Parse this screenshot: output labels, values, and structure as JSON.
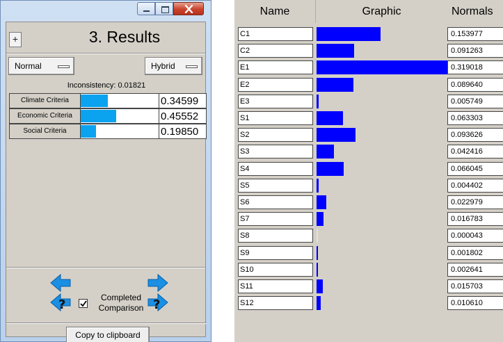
{
  "results_window": {
    "title": "3. Results",
    "plus_label": "+",
    "mode_dropdown": "Normal",
    "method_dropdown": "Hybrid",
    "inconsistency": "Inconsistency: 0.01821",
    "criteria": [
      {
        "label": "Climate Criteria",
        "value": "0.34599",
        "fraction": 0.34599
      },
      {
        "label": "Economic Criteria",
        "value": "0.45552",
        "fraction": 0.45552
      },
      {
        "label": "Social Criteria",
        "value": "0.19850",
        "fraction": 0.1985
      }
    ],
    "completed_label_line1": "Completed",
    "completed_label_line2": "Comparison",
    "completed_checked": true,
    "copy_button": "Copy to clipboard"
  },
  "normals_table": {
    "headers": {
      "name": "Name",
      "graphic": "Graphic",
      "normals": "Normals"
    },
    "rows": [
      {
        "name": "C1",
        "normal": "0.153977",
        "value": 0.153977
      },
      {
        "name": "C2",
        "normal": "0.091263",
        "value": 0.091263
      },
      {
        "name": "E1",
        "normal": "0.319018",
        "value": 0.319018
      },
      {
        "name": "E2",
        "normal": "0.089640",
        "value": 0.08964
      },
      {
        "name": "E3",
        "normal": "0.005749",
        "value": 0.005749
      },
      {
        "name": "S1",
        "normal": "0.063303",
        "value": 0.063303
      },
      {
        "name": "S2",
        "normal": "0.093626",
        "value": 0.093626
      },
      {
        "name": "S3",
        "normal": "0.042416",
        "value": 0.042416
      },
      {
        "name": "S4",
        "normal": "0.066045",
        "value": 0.066045
      },
      {
        "name": "S5",
        "normal": "0.004402",
        "value": 0.004402
      },
      {
        "name": "S6",
        "normal": "0.022979",
        "value": 0.022979
      },
      {
        "name": "S7",
        "normal": "0.016783",
        "value": 0.016783
      },
      {
        "name": "S8",
        "normal": "0.000043",
        "value": 4.3e-05
      },
      {
        "name": "S9",
        "normal": "0.001802",
        "value": 0.001802
      },
      {
        "name": "S10",
        "normal": "0.002641",
        "value": 0.002641
      },
      {
        "name": "S11",
        "normal": "0.015703",
        "value": 0.015703
      },
      {
        "name": "S12",
        "normal": "0.010610",
        "value": 0.01061
      }
    ]
  },
  "colors": {
    "criteria_fill": "#0ba3ef",
    "graphic_bar": "#0000ff",
    "window_face": "#d4d0c8",
    "close_button": "#c8422c"
  },
  "icons": {
    "title_min": "minimize-icon",
    "title_max": "maximize-icon",
    "title_close": "close-icon",
    "nav_prev": "arrow-left-icon",
    "nav_next": "arrow-right-icon",
    "help_prev": "help-arrow-left-icon",
    "help_next": "help-arrow-right-icon"
  }
}
